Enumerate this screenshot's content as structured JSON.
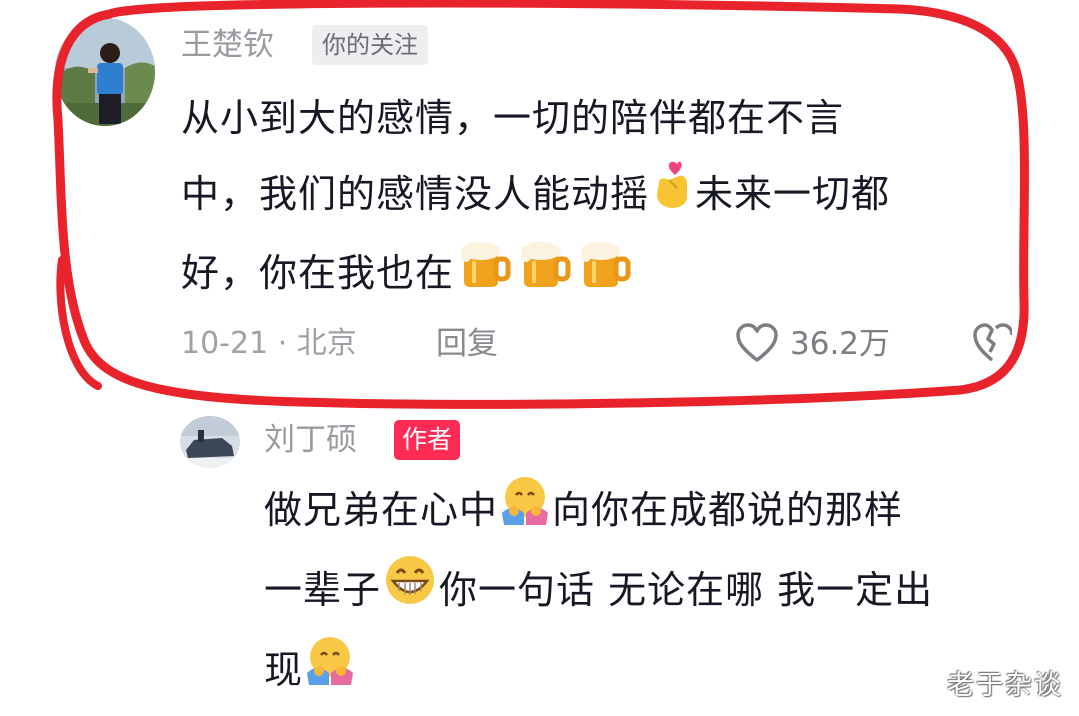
{
  "comment": {
    "username": "王楚钦",
    "follow_badge": "你的关注",
    "lines": [
      [
        "从小到大的感情，一切的陪伴都在不言"
      ],
      [
        "中，我们的感情没人能动摇",
        "emoji:heart-hand",
        "未来一切都"
      ],
      [
        "好，你在我也在",
        "emoji:beer",
        "emoji:beer",
        "emoji:beer"
      ]
    ],
    "line1": "从小到大的感情，一切的陪伴都在不言",
    "line2a": "中，我们的感情没人能动摇",
    "line2b": "未来一切都",
    "line3a": "好，你在我也在",
    "meta": "10-21 · 北京",
    "reply_label": "回复",
    "like_count": "36.2万"
  },
  "reply": {
    "username": "刘丁硕",
    "author_badge": "作者",
    "line1a": "做兄弟在心中",
    "line1b": "向你在成都说的那样",
    "line2a": "一辈子",
    "line2b": "你一句话 无论在哪 我一定出",
    "line3a": "现"
  },
  "watermark": "老于杂谈",
  "colors": {
    "highlight": "#e8232b",
    "author_badge": "#fe2c55",
    "text": "#161823",
    "secondary": "#9a9ba0"
  },
  "icons": [
    "heart-hand-emoji",
    "beer-mug-emoji",
    "hug-emoji",
    "grin-emoji",
    "like-heart-icon",
    "dislike-broken-heart-icon"
  ]
}
